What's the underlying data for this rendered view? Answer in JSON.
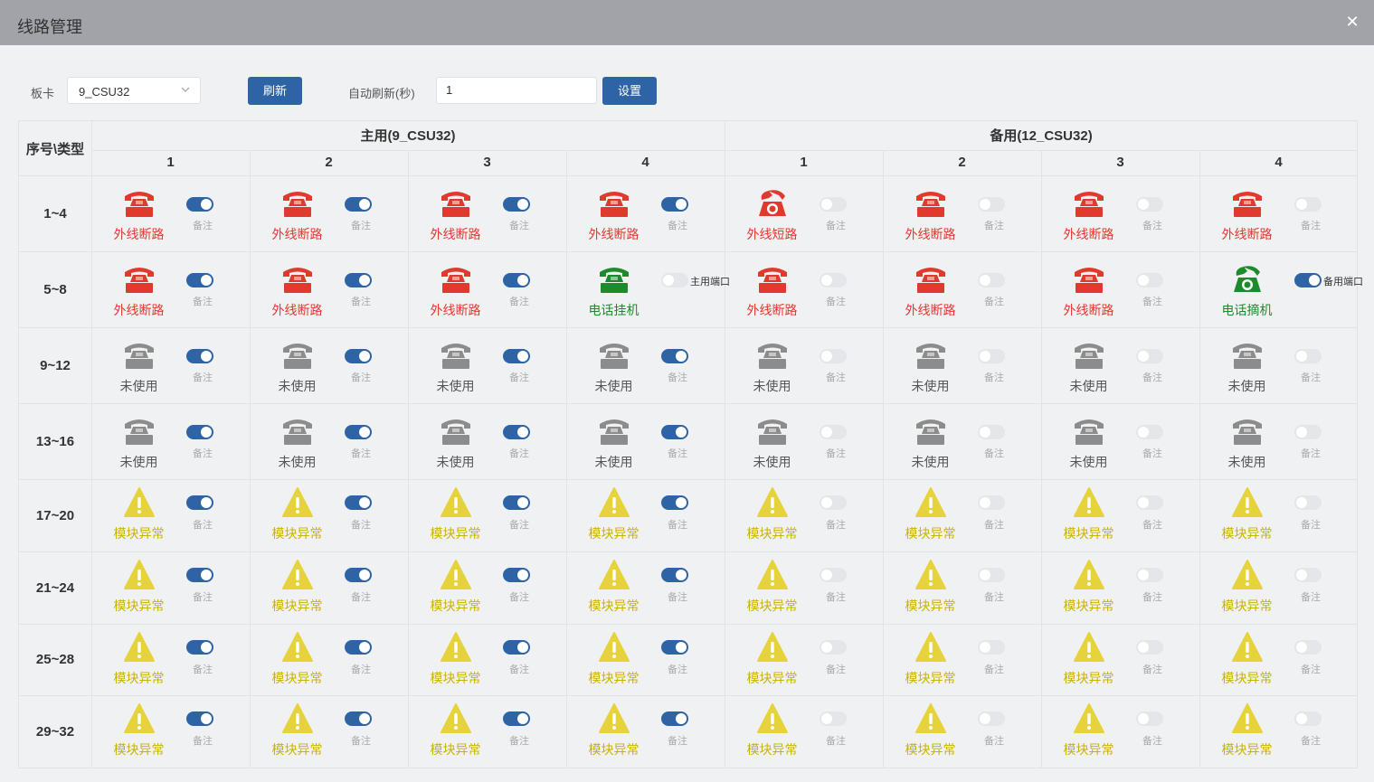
{
  "window": {
    "title": "线路管理",
    "close_icon": "close-icon"
  },
  "toolbar": {
    "board_label": "板卡",
    "board_value": "9_CSU32",
    "refresh_label": "刷新",
    "auto_refresh_label": "自动刷新(秒)",
    "auto_refresh_value": "1",
    "set_label": "设置"
  },
  "grid": {
    "corner": "序号\\类型",
    "groups": [
      "主用(9_CSU32)",
      "备用(12_CSU32)"
    ],
    "subcols": [
      "1",
      "2",
      "3",
      "4",
      "1",
      "2",
      "3",
      "4"
    ],
    "rows": [
      {
        "label": "1~4",
        "cells": [
          {
            "status": "外线断路",
            "icon": "phone-red",
            "on": true,
            "note": "备注"
          },
          {
            "status": "外线断路",
            "icon": "phone-red",
            "on": true,
            "note": "备注"
          },
          {
            "status": "外线断路",
            "icon": "phone-red",
            "on": true,
            "note": "备注"
          },
          {
            "status": "外线断路",
            "icon": "phone-red",
            "on": true,
            "note": "备注"
          },
          {
            "status": "外线短路",
            "icon": "phone-red-offhook",
            "on": false,
            "note": "备注"
          },
          {
            "status": "外线断路",
            "icon": "phone-red",
            "on": false,
            "note": "备注"
          },
          {
            "status": "外线断路",
            "icon": "phone-red",
            "on": false,
            "note": "备注"
          },
          {
            "status": "外线断路",
            "icon": "phone-red",
            "on": false,
            "note": "备注"
          }
        ]
      },
      {
        "label": "5~8",
        "cells": [
          {
            "status": "外线断路",
            "icon": "phone-red",
            "on": true,
            "note": "备注"
          },
          {
            "status": "外线断路",
            "icon": "phone-red",
            "on": true,
            "note": "备注"
          },
          {
            "status": "外线断路",
            "icon": "phone-red",
            "on": true,
            "note": "备注"
          },
          {
            "status": "电话挂机",
            "icon": "phone-green",
            "on": false,
            "note": "主用端口"
          },
          {
            "status": "外线断路",
            "icon": "phone-red",
            "on": false,
            "note": "备注"
          },
          {
            "status": "外线断路",
            "icon": "phone-red",
            "on": false,
            "note": "备注"
          },
          {
            "status": "外线断路",
            "icon": "phone-red",
            "on": false,
            "note": "备注"
          },
          {
            "status": "电话摘机",
            "icon": "phone-green-offhook",
            "on": true,
            "note": "备用端口"
          }
        ]
      },
      {
        "label": "9~12",
        "cells": [
          {
            "status": "未使用",
            "icon": "phone-gray",
            "on": true,
            "note": "备注"
          },
          {
            "status": "未使用",
            "icon": "phone-gray",
            "on": true,
            "note": "备注"
          },
          {
            "status": "未使用",
            "icon": "phone-gray",
            "on": true,
            "note": "备注"
          },
          {
            "status": "未使用",
            "icon": "phone-gray",
            "on": true,
            "note": "备注"
          },
          {
            "status": "未使用",
            "icon": "phone-gray",
            "on": false,
            "note": "备注"
          },
          {
            "status": "未使用",
            "icon": "phone-gray",
            "on": false,
            "note": "备注"
          },
          {
            "status": "未使用",
            "icon": "phone-gray",
            "on": false,
            "note": "备注"
          },
          {
            "status": "未使用",
            "icon": "phone-gray",
            "on": false,
            "note": "备注"
          }
        ]
      },
      {
        "label": "13~16",
        "cells": [
          {
            "status": "未使用",
            "icon": "phone-gray",
            "on": true,
            "note": "备注"
          },
          {
            "status": "未使用",
            "icon": "phone-gray",
            "on": true,
            "note": "备注"
          },
          {
            "status": "未使用",
            "icon": "phone-gray",
            "on": true,
            "note": "备注"
          },
          {
            "status": "未使用",
            "icon": "phone-gray",
            "on": true,
            "note": "备注"
          },
          {
            "status": "未使用",
            "icon": "phone-gray",
            "on": false,
            "note": "备注"
          },
          {
            "status": "未使用",
            "icon": "phone-gray",
            "on": false,
            "note": "备注"
          },
          {
            "status": "未使用",
            "icon": "phone-gray",
            "on": false,
            "note": "备注"
          },
          {
            "status": "未使用",
            "icon": "phone-gray",
            "on": false,
            "note": "备注"
          }
        ]
      },
      {
        "label": "17~20",
        "cells": [
          {
            "status": "模块异常",
            "icon": "warning",
            "on": true,
            "note": "备注"
          },
          {
            "status": "模块异常",
            "icon": "warning",
            "on": true,
            "note": "备注"
          },
          {
            "status": "模块异常",
            "icon": "warning",
            "on": true,
            "note": "备注"
          },
          {
            "status": "模块异常",
            "icon": "warning",
            "on": true,
            "note": "备注"
          },
          {
            "status": "模块异常",
            "icon": "warning",
            "on": false,
            "note": "备注"
          },
          {
            "status": "模块异常",
            "icon": "warning",
            "on": false,
            "note": "备注"
          },
          {
            "status": "模块异常",
            "icon": "warning",
            "on": false,
            "note": "备注"
          },
          {
            "status": "模块异常",
            "icon": "warning",
            "on": false,
            "note": "备注"
          }
        ]
      },
      {
        "label": "21~24",
        "cells": [
          {
            "status": "模块异常",
            "icon": "warning",
            "on": true,
            "note": "备注"
          },
          {
            "status": "模块异常",
            "icon": "warning",
            "on": true,
            "note": "备注"
          },
          {
            "status": "模块异常",
            "icon": "warning",
            "on": true,
            "note": "备注"
          },
          {
            "status": "模块异常",
            "icon": "warning",
            "on": true,
            "note": "备注"
          },
          {
            "status": "模块异常",
            "icon": "warning",
            "on": false,
            "note": "备注"
          },
          {
            "status": "模块异常",
            "icon": "warning",
            "on": false,
            "note": "备注"
          },
          {
            "status": "模块异常",
            "icon": "warning",
            "on": false,
            "note": "备注"
          },
          {
            "status": "模块异常",
            "icon": "warning",
            "on": false,
            "note": "备注"
          }
        ]
      },
      {
        "label": "25~28",
        "cells": [
          {
            "status": "模块异常",
            "icon": "warning",
            "on": true,
            "note": "备注"
          },
          {
            "status": "模块异常",
            "icon": "warning",
            "on": true,
            "note": "备注"
          },
          {
            "status": "模块异常",
            "icon": "warning",
            "on": true,
            "note": "备注"
          },
          {
            "status": "模块异常",
            "icon": "warning",
            "on": true,
            "note": "备注"
          },
          {
            "status": "模块异常",
            "icon": "warning",
            "on": false,
            "note": "备注"
          },
          {
            "status": "模块异常",
            "icon": "warning",
            "on": false,
            "note": "备注"
          },
          {
            "status": "模块异常",
            "icon": "warning",
            "on": false,
            "note": "备注"
          },
          {
            "status": "模块异常",
            "icon": "warning",
            "on": false,
            "note": "备注"
          }
        ]
      },
      {
        "label": "29~32",
        "cells": [
          {
            "status": "模块异常",
            "icon": "warning",
            "on": true,
            "note": "备注"
          },
          {
            "status": "模块异常",
            "icon": "warning",
            "on": true,
            "note": "备注"
          },
          {
            "status": "模块异常",
            "icon": "warning",
            "on": true,
            "note": "备注"
          },
          {
            "status": "模块异常",
            "icon": "warning",
            "on": true,
            "note": "备注"
          },
          {
            "status": "模块异常",
            "icon": "warning",
            "on": false,
            "note": "备注"
          },
          {
            "status": "模块异常",
            "icon": "warning",
            "on": false,
            "note": "备注"
          },
          {
            "status": "模块异常",
            "icon": "warning",
            "on": false,
            "note": "备注"
          },
          {
            "status": "模块异常",
            "icon": "warning",
            "on": false,
            "note": "备注"
          }
        ]
      }
    ]
  },
  "colors": {
    "accent": "#2e63a5",
    "red": "#e03a2f",
    "green": "#1e8a2e",
    "gray": "#8c8c8c",
    "yellow": "#e6d23a",
    "status_red_text": "#e03a2f",
    "status_green_text": "#1e8a2e",
    "status_gray_text": "#555555",
    "status_yellow_text": "#c8b400"
  }
}
